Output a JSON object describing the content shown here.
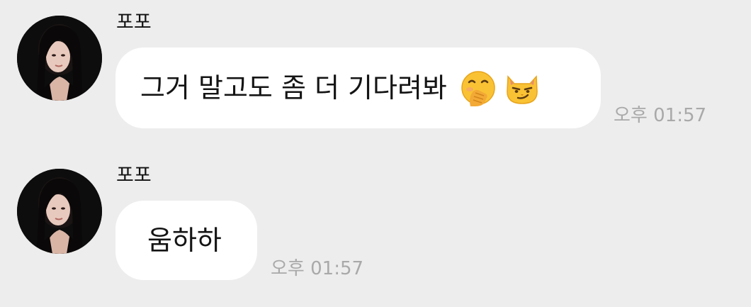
{
  "messages": [
    {
      "sender": "포포",
      "text": "그거 말고도 좀 더 기다려봐",
      "emojis": [
        "hand-over-mouth-emoji",
        "smirking-cat-emoji"
      ],
      "time": "오후 01:57"
    },
    {
      "sender": "포포",
      "text": "움하하",
      "time": "오후 01:57"
    }
  ],
  "colors": {
    "background": "#ededed",
    "bubble": "#ffffff",
    "text": "#141414",
    "timestamp": "#a9a9a9"
  }
}
